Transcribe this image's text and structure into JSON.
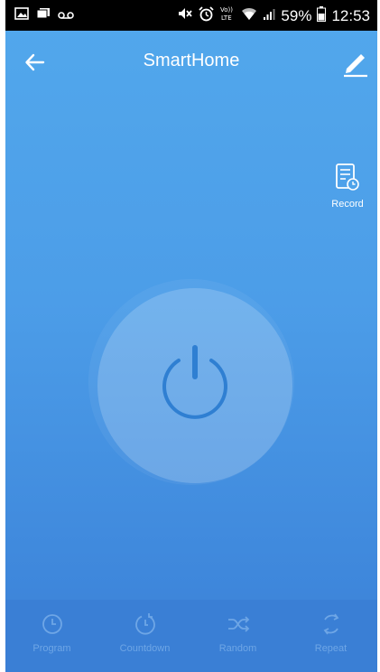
{
  "status_bar": {
    "battery_percent": "59%",
    "time": "12:53",
    "left_icons": [
      "gallery-icon",
      "messages-icon",
      "voicemail-icon"
    ],
    "right_icons": [
      "mute-icon",
      "alarm-icon",
      "volte-icon",
      "wifi-icon",
      "signal-icon",
      "battery-icon"
    ],
    "volte_label": "Vo)) LTE"
  },
  "app_bar": {
    "title": "SmartHome",
    "back_icon": "back-arrow-icon",
    "edit_icon": "edit-pencil-icon"
  },
  "record": {
    "label": "Record",
    "icon": "record-log-icon"
  },
  "power": {
    "icon": "power-icon"
  },
  "bottom_tabs": [
    {
      "label": "Program",
      "icon": "clock-icon"
    },
    {
      "label": "Countdown",
      "icon": "countdown-icon"
    },
    {
      "label": "Random",
      "icon": "shuffle-icon"
    },
    {
      "label": "Repeat",
      "icon": "repeat-icon"
    }
  ],
  "colors": {
    "background_top": "#52a8ec",
    "background_bottom": "#3a80d6",
    "tab_label": "#6ea6e6",
    "text": "#ffffff"
  }
}
